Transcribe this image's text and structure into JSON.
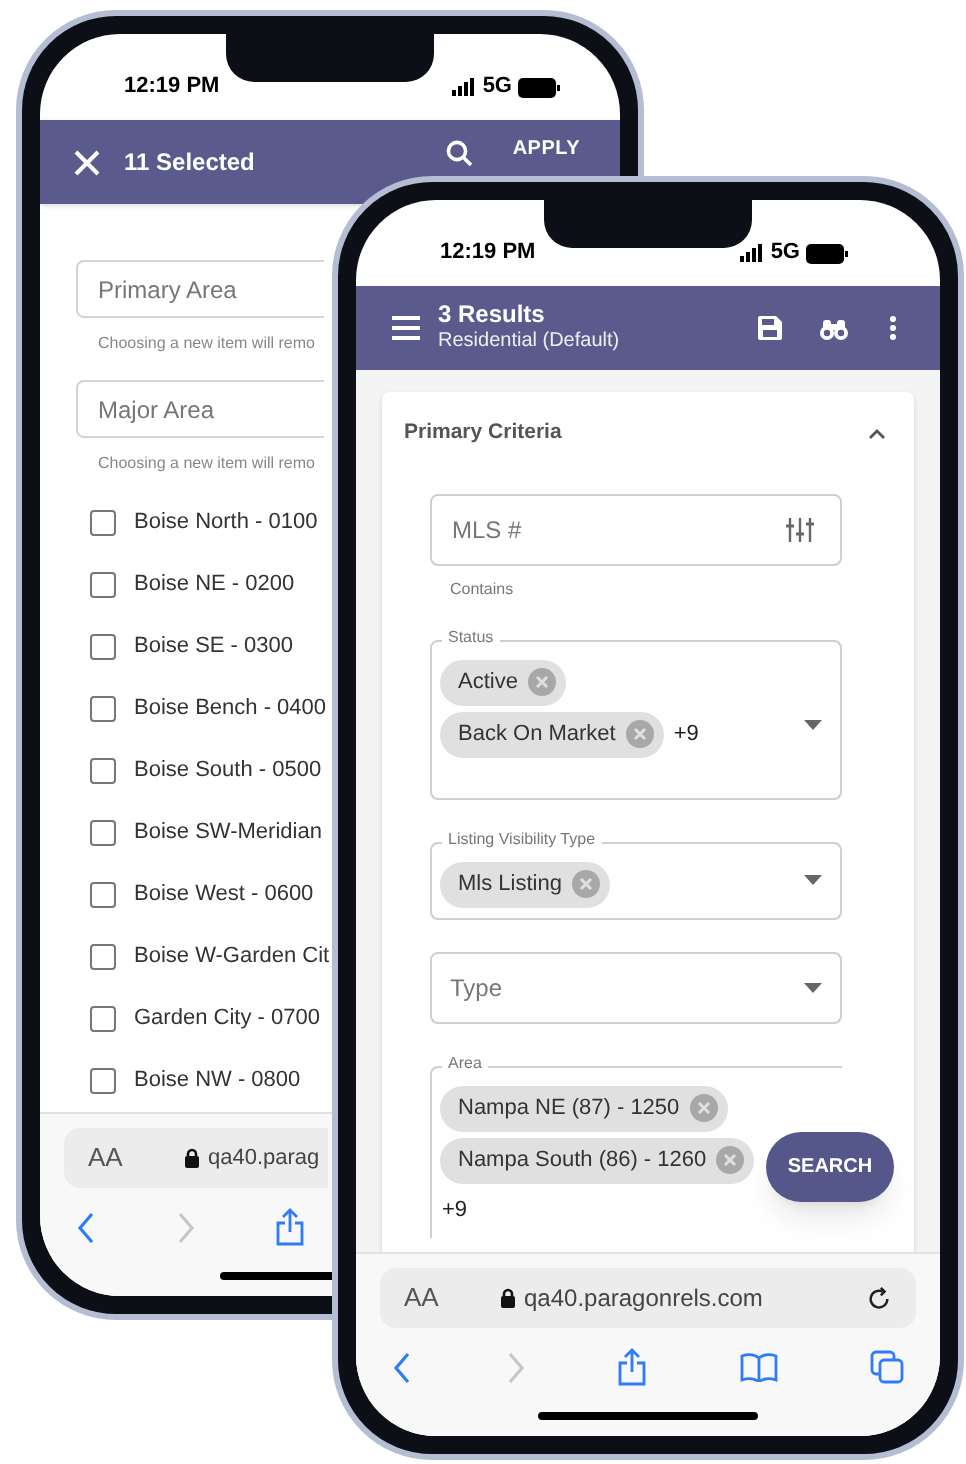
{
  "back_phone": {
    "status_bar": {
      "time": "12:19 PM",
      "network": "5G"
    },
    "header": {
      "title": "11 Selected",
      "action": "APPLY"
    },
    "fields": [
      {
        "placeholder": "Primary Area",
        "helper": "Choosing a new item will remo"
      },
      {
        "placeholder": "Major Area",
        "helper": "Choosing a new item will remo"
      }
    ],
    "options": [
      {
        "label": "Boise North - 0100",
        "checked": false
      },
      {
        "label": "Boise NE - 0200",
        "checked": false
      },
      {
        "label": "Boise SE - 0300",
        "checked": false
      },
      {
        "label": "Boise Bench - 0400",
        "checked": false
      },
      {
        "label": "Boise South - 0500",
        "checked": false
      },
      {
        "label": "Boise SW-Meridian",
        "checked": false
      },
      {
        "label": "Boise West - 0600",
        "checked": false
      },
      {
        "label": "Boise W-Garden Cit",
        "checked": false
      },
      {
        "label": "Garden City - 0700",
        "checked": false
      },
      {
        "label": "Boise NW - 0800",
        "checked": false
      }
    ],
    "browser": {
      "text_size": "AA",
      "url": "qa40.parag"
    }
  },
  "front_phone": {
    "status_bar": {
      "time": "12:19 PM",
      "network": "5G"
    },
    "header": {
      "title": "3 Results",
      "subtitle": "Residential (Default)"
    },
    "section": {
      "title": "Primary Criteria",
      "expanded": true
    },
    "mls_field": {
      "placeholder": "MLS #",
      "helper": "Contains"
    },
    "selects": [
      {
        "label": "Status",
        "chips": [
          "Active",
          "Back On Market"
        ],
        "more": "+9"
      },
      {
        "label": "Listing Visibility Type",
        "chips": [
          "Mls Listing"
        ]
      },
      {
        "placeholder": "Type"
      },
      {
        "label": "Area",
        "chips": [
          "Nampa NE (87) - 1250",
          "Nampa South (86) - 1260"
        ],
        "more": "+9"
      }
    ],
    "search_button": "SEARCH",
    "browser": {
      "text_size": "AA",
      "url": "qa40.paragonrels.com"
    }
  }
}
